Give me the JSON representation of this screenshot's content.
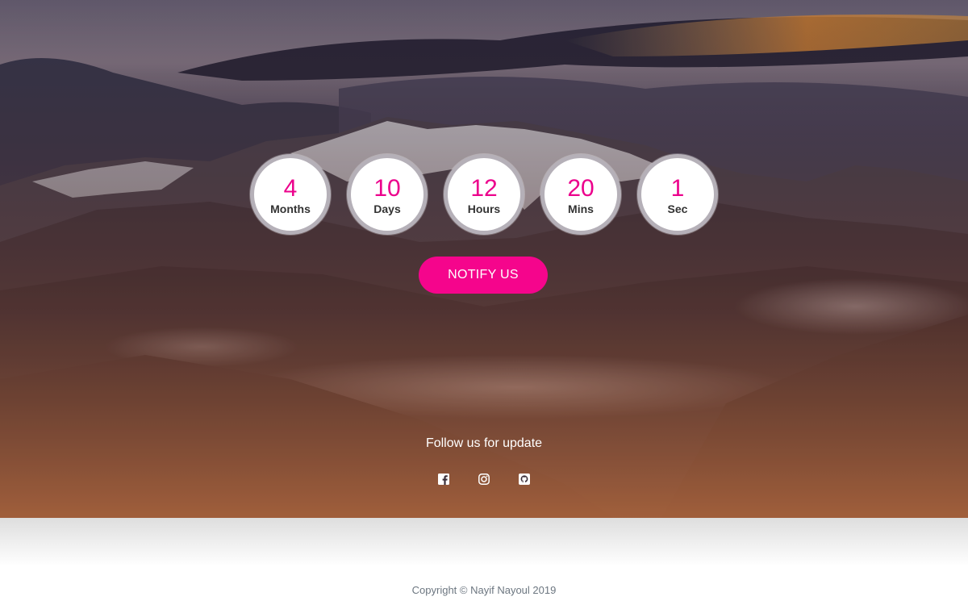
{
  "countdown": {
    "units": [
      {
        "value": "4",
        "label": "Months"
      },
      {
        "value": "10",
        "label": "Days"
      },
      {
        "value": "12",
        "label": "Hours"
      },
      {
        "value": "20",
        "label": "Mins"
      },
      {
        "value": "1",
        "label": "Sec"
      }
    ]
  },
  "notify_button": {
    "label": "NOTIFY US"
  },
  "follow": {
    "text": "Follow us for update"
  },
  "social": {
    "icons": [
      "facebook-icon",
      "instagram-icon",
      "github-icon"
    ]
  },
  "footer": {
    "copyright": "Copyright © Nayif Nayoul 2019"
  },
  "colors": {
    "accent": "#f5058c",
    "countdown_value": "#ec008c",
    "ring": "#b5b0b8"
  }
}
